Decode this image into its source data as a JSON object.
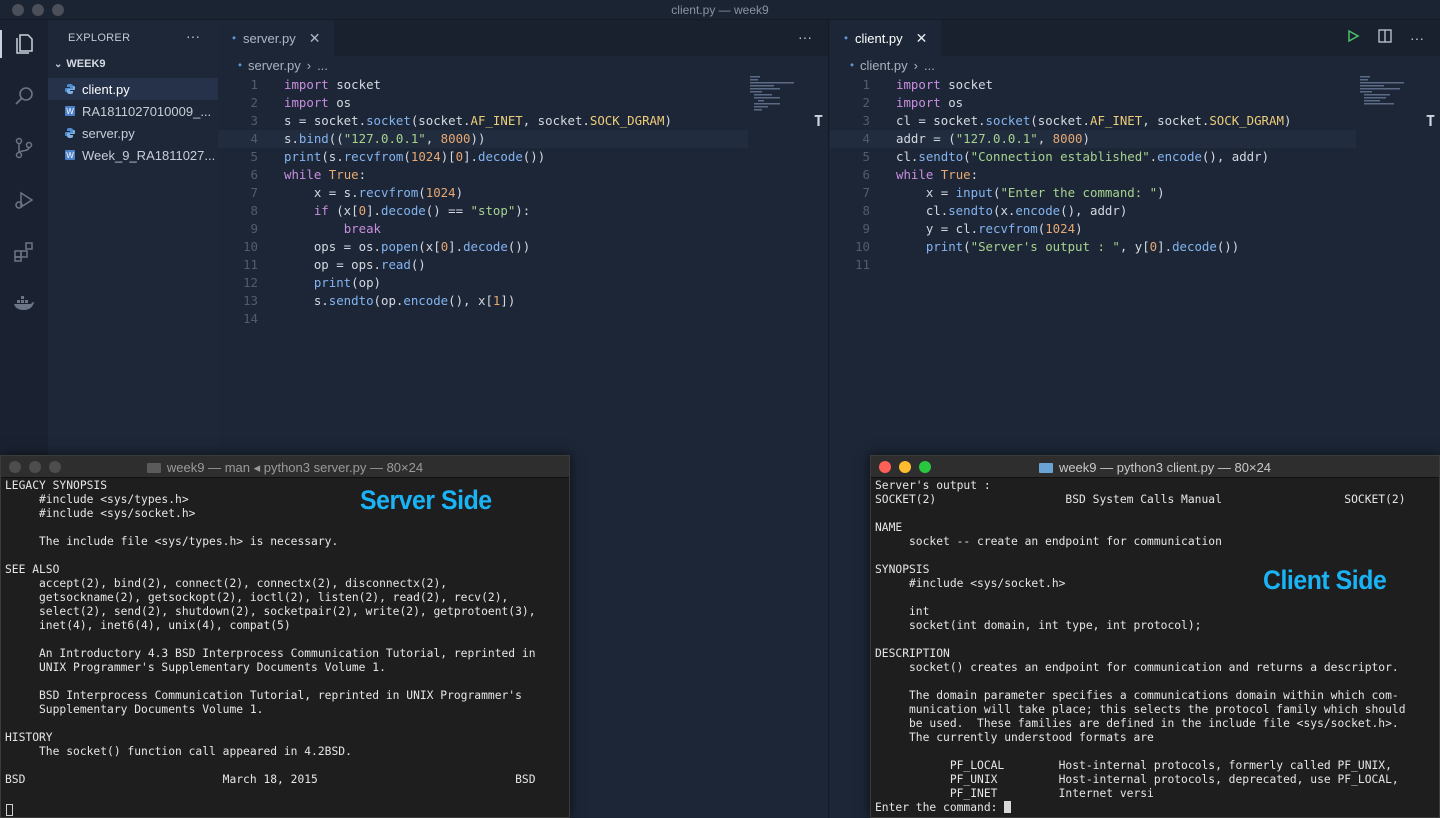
{
  "window": {
    "title": "client.py — week9"
  },
  "explorer": {
    "header": "EXPLORER",
    "more": "···",
    "folder": "WEEK9",
    "files": [
      {
        "name": "client.py",
        "type": "python"
      },
      {
        "name": "RA1811027010009_...",
        "type": "doc"
      },
      {
        "name": "server.py",
        "type": "python"
      },
      {
        "name": "Week_9_RA1811027...",
        "type": "doc"
      }
    ]
  },
  "editors": {
    "left": {
      "tab": "server.py",
      "close": "✕",
      "more": "···",
      "breadcrumb_file": "server.py",
      "breadcrumb_rest": "...",
      "line_numbers": [
        "1",
        "2",
        "3",
        "4",
        "5",
        "6",
        "7",
        "8",
        "9",
        "10",
        "11",
        "12",
        "13",
        "14"
      ]
    },
    "right": {
      "tab": "client.py",
      "close": "✕",
      "more": "···",
      "breadcrumb_file": "client.py",
      "breadcrumb_rest": "...",
      "line_numbers": [
        "1",
        "2",
        "3",
        "4",
        "5",
        "6",
        "7",
        "8",
        "9",
        "10",
        "11"
      ]
    }
  },
  "terminals": {
    "server": {
      "title": "week9 — man ◂ python3 server.py — 80×24",
      "banner": "Server Side",
      "lines": [
        "LEGACY SYNOPSIS",
        "     #include <sys/types.h>",
        "     #include <sys/socket.h>",
        "",
        "     The include file <sys/types.h> is necessary.",
        "",
        "SEE ALSO",
        "     accept(2), bind(2), connect(2), connectx(2), disconnectx(2),",
        "     getsockname(2), getsockopt(2), ioctl(2), listen(2), read(2), recv(2),",
        "     select(2), send(2), shutdown(2), socketpair(2), write(2), getprotoent(3),",
        "     inet(4), inet6(4), unix(4), compat(5)",
        "",
        "     An Introductory 4.3 BSD Interprocess Communication Tutorial, reprinted in",
        "     UNIX Programmer's Supplementary Documents Volume 1.",
        "",
        "     BSD Interprocess Communication Tutorial, reprinted in UNIX Programmer's",
        "     Supplementary Documents Volume 1.",
        "",
        "HISTORY",
        "     The socket() function call appeared in 4.2BSD.",
        "",
        "BSD                             March 18, 2015                             BSD",
        ""
      ]
    },
    "client": {
      "title": "week9 — python3 client.py — 80×24",
      "banner": "Client Side",
      "lines": [
        "Server's output :",
        "SOCKET(2)                   BSD System Calls Manual                  SOCKET(2)",
        "",
        "NAME",
        "     socket -- create an endpoint for communication",
        "",
        "SYNOPSIS",
        "     #include <sys/socket.h>",
        "",
        "     int",
        "     socket(int domain, int type, int protocol);",
        "",
        "DESCRIPTION",
        "     socket() creates an endpoint for communication and returns a descriptor.",
        "",
        "     The domain parameter specifies a communications domain within which com-",
        "     munication will take place; this selects the protocol family which should",
        "     be used.  These families are defined in the include file <sys/socket.h>.",
        "     The currently understood formats are",
        "",
        "           PF_LOCAL        Host-internal protocols, formerly called PF_UNIX,",
        "           PF_UNIX         Host-internal protocols, deprecated, use PF_LOCAL,",
        "           PF_INET         Internet versi"
      ],
      "prompt": "Enter the command: "
    }
  },
  "colors": {
    "keyword": "#c98ede",
    "function": "#84b4f0",
    "string": "#a7d38f",
    "number": "#e7a872",
    "banner": "#1ab3f5"
  }
}
